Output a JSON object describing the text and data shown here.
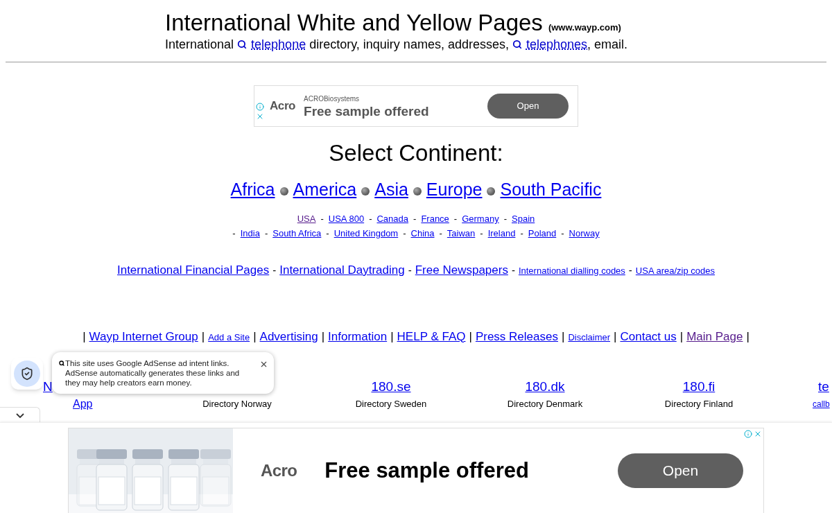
{
  "header": {
    "title": "International White and Yellow Pages",
    "site": "(www.wayp.com)",
    "tagline": [
      {
        "kind": "text",
        "text": "International"
      },
      {
        "kind": "search-link",
        "text": "telephone"
      },
      {
        "kind": "text",
        "text": "directory, inquiry names, addresses,"
      },
      {
        "kind": "search-link",
        "text": "telephones",
        "after": ","
      },
      {
        "kind": "text",
        "text": "email."
      }
    ]
  },
  "top_ad": {
    "advertiser": "ACROBiosystems",
    "logo": "Acro",
    "headline": "Free sample offered",
    "button": "Open"
  },
  "continents": {
    "heading": "Select Continent:",
    "links": [
      "Africa",
      "America",
      "Asia",
      "Europe",
      "South Pacific"
    ]
  },
  "countries": [
    [
      {
        "kind": "link",
        "text": "USA",
        "visited": true
      },
      {
        "kind": "sep",
        "text": "-"
      },
      {
        "kind": "link",
        "text": "USA 800",
        "visited": false
      },
      {
        "kind": "sep",
        "text": "-"
      },
      {
        "kind": "link",
        "text": "Canada",
        "visited": false
      },
      {
        "kind": "sep",
        "text": "-"
      },
      {
        "kind": "link",
        "text": "France",
        "visited": false
      },
      {
        "kind": "sep",
        "text": "-"
      },
      {
        "kind": "link",
        "text": "Germany",
        "visited": false
      },
      {
        "kind": "sep",
        "text": "-"
      },
      {
        "kind": "link",
        "text": "Spain",
        "visited": false
      }
    ],
    [
      {
        "kind": "sep",
        "text": "-"
      },
      {
        "kind": "link",
        "text": "India",
        "visited": false
      },
      {
        "kind": "sep",
        "text": "-"
      },
      {
        "kind": "link",
        "text": "South Africa",
        "visited": false
      },
      {
        "kind": "sep",
        "text": "-"
      },
      {
        "kind": "link",
        "text": "United Kingdom",
        "visited": false
      },
      {
        "kind": "sep",
        "text": "-"
      },
      {
        "kind": "link",
        "text": "China",
        "visited": false
      },
      {
        "kind": "sep",
        "text": "-"
      },
      {
        "kind": "link",
        "text": "Taiwan",
        "visited": false
      },
      {
        "kind": "sep",
        "text": "-"
      },
      {
        "kind": "link",
        "text": "Ireland",
        "visited": false
      },
      {
        "kind": "sep",
        "text": "-"
      },
      {
        "kind": "link",
        "text": "Poland",
        "visited": false
      },
      {
        "kind": "sep",
        "text": "-"
      },
      {
        "kind": "link",
        "text": "Norway",
        "visited": false
      }
    ]
  ],
  "resources": [
    {
      "kind": "major",
      "text": "International Financial Pages"
    },
    {
      "kind": "sep",
      "text": "-"
    },
    {
      "kind": "major",
      "text": "International Daytrading"
    },
    {
      "kind": "sep",
      "text": "-"
    },
    {
      "kind": "major",
      "text": "Free Newspapers"
    },
    {
      "kind": "sep",
      "text": "-"
    },
    {
      "kind": "minor",
      "text": "International dialling codes"
    },
    {
      "kind": "sep",
      "text": "-"
    },
    {
      "kind": "minor",
      "text": "USA area/zip codes"
    }
  ],
  "footer_links": [
    {
      "kind": "sep",
      "text": "|"
    },
    {
      "kind": "major",
      "text": "Wayp Internet Group",
      "visited": false
    },
    {
      "kind": "sep",
      "text": "|"
    },
    {
      "kind": "minor",
      "text": "Add a Site",
      "visited": false
    },
    {
      "kind": "sep",
      "text": "|"
    },
    {
      "kind": "major",
      "text": "Advertising",
      "visited": false
    },
    {
      "kind": "sep",
      "text": "|"
    },
    {
      "kind": "major",
      "text": "Information",
      "visited": false
    },
    {
      "kind": "sep",
      "text": "|"
    },
    {
      "kind": "major",
      "text": "HELP  & FAQ",
      "visited": false
    },
    {
      "kind": "sep",
      "text": "|"
    },
    {
      "kind": "major",
      "text": "Press Releases",
      "visited": false
    },
    {
      "kind": "sep",
      "text": "|"
    },
    {
      "kind": "minor",
      "text": "Disclaimer",
      "visited": false
    },
    {
      "kind": "sep",
      "text": "|"
    },
    {
      "kind": "major",
      "text": "Contact us",
      "visited": false
    },
    {
      "kind": "sep",
      "text": "|"
    },
    {
      "kind": "major",
      "text": "Main Page",
      "visited": true
    },
    {
      "kind": "sep",
      "text": "|"
    }
  ],
  "directories": [
    {
      "title": "N",
      "subtitle": "App",
      "kind": "link"
    },
    {
      "subtitle": "Directory Norway",
      "kind": "text"
    },
    {
      "title": "180.se",
      "subtitle": "Directory Sweden",
      "kind": "text"
    },
    {
      "title": "180.dk",
      "subtitle": "Directory Denmark",
      "kind": "text"
    },
    {
      "title": "180.fi",
      "subtitle": "Directory Finland",
      "kind": "text"
    },
    {
      "title": "te",
      "subtitle": "callb",
      "kind": "link"
    }
  ],
  "adsense_notice": {
    "text": "This site uses Google AdSense ad intent links. AdSense automatically generates these links and they may help creators earn money."
  },
  "bottom_ad": {
    "logo": "Acro",
    "headline": "Free sample offered",
    "button": "Open"
  }
}
